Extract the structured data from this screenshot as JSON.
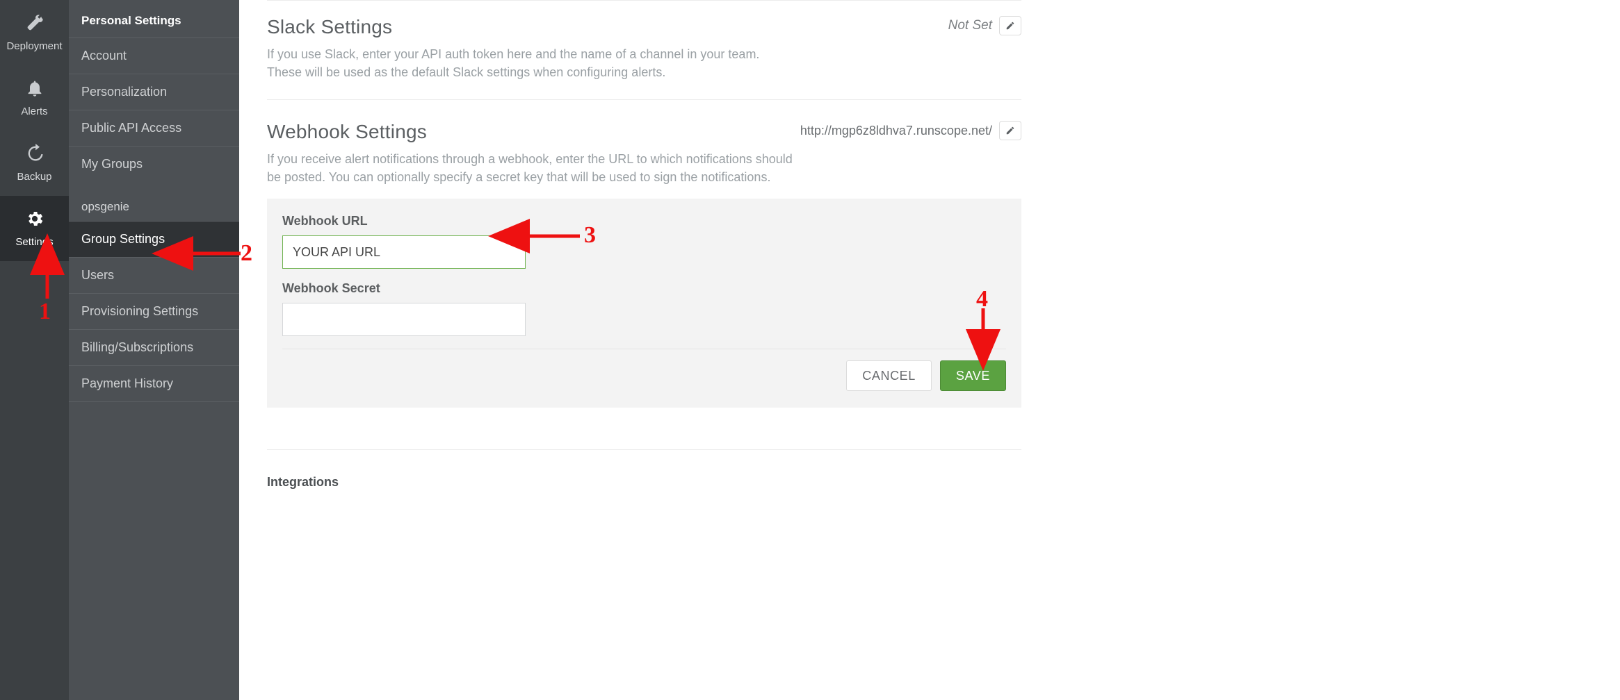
{
  "iconrail": {
    "items": [
      {
        "id": "deployment",
        "label": "Deployment"
      },
      {
        "id": "alerts",
        "label": "Alerts"
      },
      {
        "id": "backup",
        "label": "Backup"
      },
      {
        "id": "settings",
        "label": "Settings",
        "active": true
      }
    ]
  },
  "sidebar": {
    "sectionA": {
      "header": "Personal Settings",
      "items": [
        {
          "id": "account",
          "label": "Account"
        },
        {
          "id": "personalization",
          "label": "Personalization"
        },
        {
          "id": "public-api",
          "label": "Public API Access"
        },
        {
          "id": "my-groups",
          "label": "My Groups"
        }
      ]
    },
    "sectionB": {
      "groupName": "opsgenie",
      "items": [
        {
          "id": "group-settings",
          "label": "Group Settings",
          "active": true
        },
        {
          "id": "users",
          "label": "Users"
        },
        {
          "id": "provisioning",
          "label": "Provisioning Settings"
        },
        {
          "id": "billing",
          "label": "Billing/Subscriptions"
        },
        {
          "id": "payment-history",
          "label": "Payment History"
        }
      ]
    }
  },
  "sections": {
    "slack": {
      "title": "Slack Settings",
      "status": "Not Set",
      "desc": "If you use Slack, enter your API auth token here and the name of a channel in your team. These will be used as the default Slack settings when configuring alerts."
    },
    "webhook": {
      "title": "Webhook Settings",
      "currentValue": "http://mgp6z8ldhva7.runscope.net/",
      "desc": "If you receive alert notifications through a webhook, enter the URL to which notifications should be posted. You can optionally specify a secret key that will be used to sign the notifications.",
      "form": {
        "urlLabel": "Webhook URL",
        "urlValue": "YOUR API URL",
        "secretLabel": "Webhook Secret",
        "secretValue": "",
        "cancel": "CANCEL",
        "save": "SAVE"
      }
    },
    "integrations": {
      "title": "Integrations"
    }
  },
  "annotations": {
    "n1": "1",
    "n2": "2",
    "n3": "3",
    "n4": "4"
  }
}
